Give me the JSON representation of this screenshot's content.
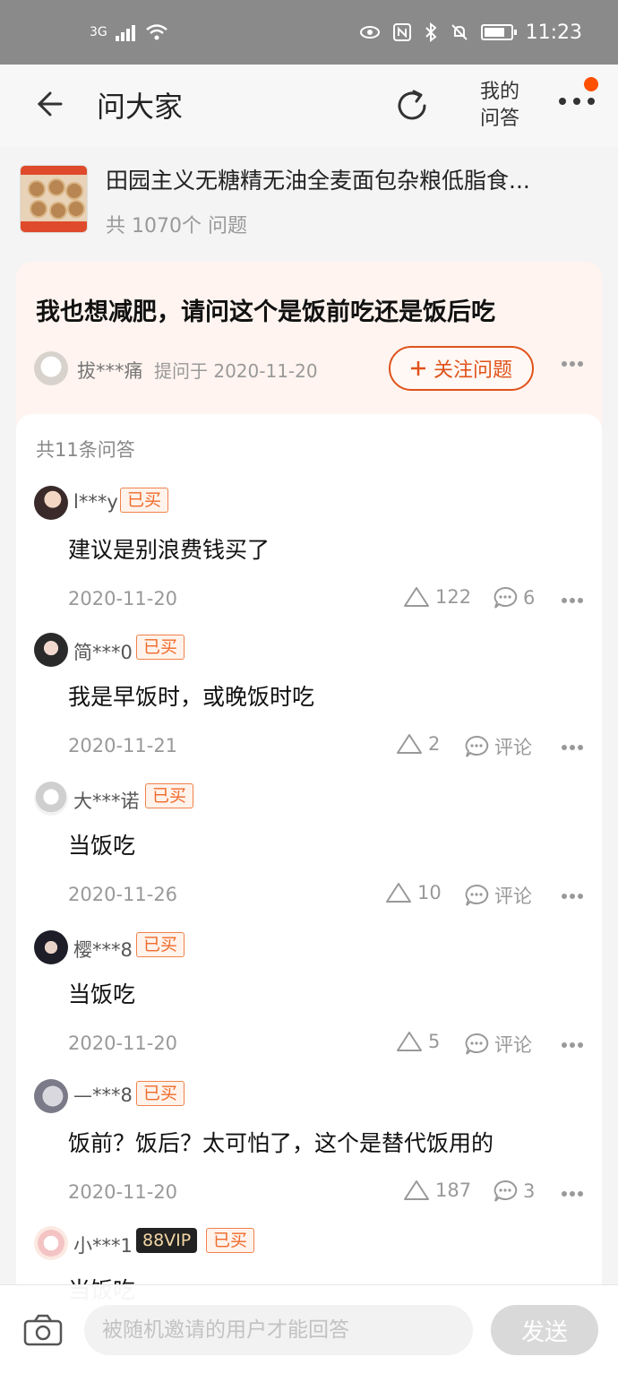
{
  "status_bar": {
    "network": "3G",
    "time": "11:23",
    "icons": [
      "signal-icon",
      "wifi-icon",
      "eye-icon",
      "nfc-icon",
      "bluetooth-icon",
      "mute-icon",
      "battery-icon"
    ]
  },
  "nav": {
    "title": "问大家",
    "my_qa_line1": "我的",
    "my_qa_line2": "问答"
  },
  "product": {
    "name": "田园主义无糖精无油全麦面包杂粮低脂食...",
    "question_count": "共 1070个 问题"
  },
  "question": {
    "text": "我也想减肥，请问这个是饭前吃还是饭后吃",
    "asker": "拔***痛",
    "asked_at": "提问于 2020-11-20",
    "follow_label": "关注问题"
  },
  "answers": {
    "total": "共11条问答",
    "bought_tag": "已买",
    "items": [
      {
        "user": "l***y",
        "content": "建议是别浪费钱买了",
        "date": "2020-11-20",
        "likes": "122",
        "comments": "6"
      },
      {
        "user": "简***0",
        "content": "我是早饭时，或晚饭时吃",
        "date": "2020-11-21",
        "likes": "2",
        "comments": "评论"
      },
      {
        "user": "大***诺",
        "content": "当饭吃",
        "date": "2020-11-26",
        "likes": "10",
        "comments": "评论"
      },
      {
        "user": "樱***8",
        "content": "当饭吃",
        "date": "2020-11-20",
        "likes": "5",
        "comments": "评论"
      },
      {
        "user": "—***8",
        "content": "饭前？饭后？太可怕了，这个是替代饭用的",
        "date": "2020-11-20",
        "likes": "187",
        "comments": "3"
      },
      {
        "user": "小***1",
        "vip": "88VIP",
        "content": "当饭吃"
      }
    ]
  },
  "bottom_bar": {
    "placeholder": "被随机邀请的用户才能回答",
    "send_label": "发送"
  },
  "colors": {
    "accent": "#ff5000",
    "follow_border": "#e0521a",
    "question_bg": "#fff4ef"
  }
}
